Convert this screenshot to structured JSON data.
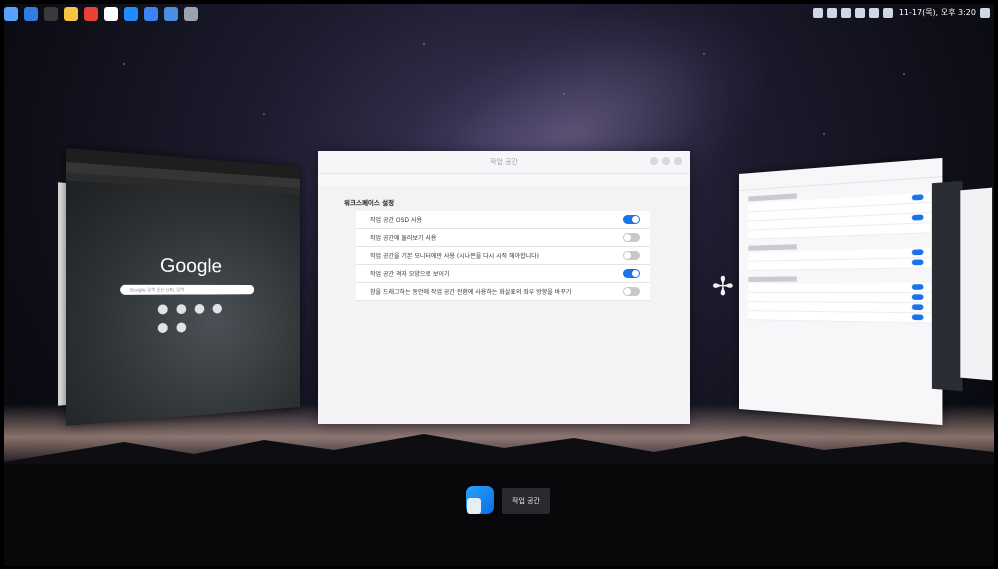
{
  "topbar": {
    "app_icons": [
      {
        "name": "launcher-icon",
        "color": "#5aa0ff"
      },
      {
        "name": "file-manager-icon",
        "color": "#2f7de1"
      },
      {
        "name": "terminal-icon",
        "color": "#3a3a3a"
      },
      {
        "name": "notes-icon",
        "color": "#f6c344"
      },
      {
        "name": "chrome-icon",
        "color": "#e94235"
      },
      {
        "name": "browser-icon",
        "color": "#ffffff"
      },
      {
        "name": "store-icon",
        "color": "#1f8cff"
      },
      {
        "name": "window-icon",
        "color": "#3b83f6"
      },
      {
        "name": "puzzle-icon",
        "color": "#4a90e2"
      },
      {
        "name": "screenshot-icon",
        "color": "#9aa3b0"
      }
    ],
    "clock": "11-17(목), 오후 3:20"
  },
  "window": {
    "title": "작업 공간",
    "section_title": "워크스페이스 설정",
    "settings": [
      {
        "label": "작업 공간 OSD 사용",
        "on": true
      },
      {
        "label": "작업 공간에 둘러보기 사용",
        "on": false
      },
      {
        "label": "작업 공간을 기본 모니터에만 사용 (시나몬을 다시 시작 해야합니다)",
        "on": false
      },
      {
        "label": "작업 공간 격자 모양으로 보이기",
        "on": true
      },
      {
        "label": "창을 드래그하는 동안에 작업 공간 전환에 사용하는 화살표의 좌우 방향을 바꾸기",
        "on": false
      }
    ]
  },
  "preview_browser": {
    "logo": "Google",
    "search_placeholder": "Google 검색 또는 URL 입력"
  },
  "workspace_label": "작업 공간",
  "colors": {
    "accent": "#1a73e8",
    "toggle_off": "#c8c8cc"
  }
}
